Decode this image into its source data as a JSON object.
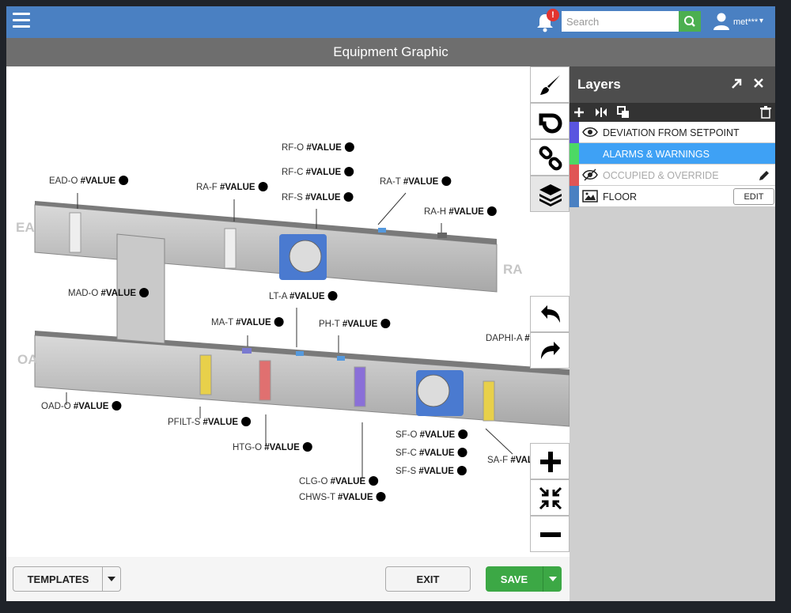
{
  "topbar": {
    "notification_badge": "!",
    "search_placeholder": "Search",
    "user_name": "met***",
    "user_caret": "▾"
  },
  "page_title": "Equipment Graphic",
  "diagram": {
    "zone_labels": {
      "ea": "EA",
      "oa": "OA",
      "ra": "RA"
    },
    "points": [
      {
        "tag": "EAD-O",
        "value": "#VALUE"
      },
      {
        "tag": "RA-F",
        "value": "#VALUE"
      },
      {
        "tag": "RF-O",
        "value": "#VALUE"
      },
      {
        "tag": "RF-C",
        "value": "#VALUE"
      },
      {
        "tag": "RF-S",
        "value": "#VALUE"
      },
      {
        "tag": "RA-T",
        "value": "#VALUE"
      },
      {
        "tag": "RA-H",
        "value": "#VALUE"
      },
      {
        "tag": "MAD-O",
        "value": "#VALUE"
      },
      {
        "tag": "LT-A",
        "value": "#VALUE"
      },
      {
        "tag": "MA-T",
        "value": "#VALUE"
      },
      {
        "tag": "PH-T",
        "value": "#VALUE"
      },
      {
        "tag": "DAPHI-A",
        "value": "#"
      },
      {
        "tag": "OAD-O",
        "value": "#VALUE"
      },
      {
        "tag": "PFILT-S",
        "value": "#VALUE"
      },
      {
        "tag": "HTG-O",
        "value": "#VALUE"
      },
      {
        "tag": "SF-O",
        "value": "#VALUE"
      },
      {
        "tag": "SF-C",
        "value": "#VALUE"
      },
      {
        "tag": "SF-S",
        "value": "#VALUE"
      },
      {
        "tag": "SA-F",
        "value": "#VAL"
      },
      {
        "tag": "CLG-O",
        "value": "#VALUE"
      },
      {
        "tag": "CHWS-T",
        "value": "#VALUE"
      }
    ]
  },
  "tools": {
    "icons": [
      "paintbrush-icon",
      "duct-icon",
      "link-icon",
      "layers-icon",
      "undo-icon",
      "redo-icon",
      "zoom-in-icon",
      "fit-icon",
      "zoom-out-icon"
    ]
  },
  "layers_panel": {
    "title": "Layers",
    "items": [
      {
        "name": "DEVIATION FROM SETPOINT",
        "color": "#5a55e0",
        "state": "visible"
      },
      {
        "name": "ALARMS & WARNINGS",
        "color": "#4cd964",
        "state": "selected"
      },
      {
        "name": "OCCUPIED & OVERRIDE",
        "color": "#e05555",
        "state": "hidden-editing"
      },
      {
        "name": "FLOOR",
        "color": "#4a80c2",
        "state": "image",
        "edit_label": "EDIT"
      }
    ]
  },
  "bottom": {
    "templates_label": "TEMPLATES",
    "exit_label": "EXIT",
    "save_label": "SAVE"
  },
  "colors": {
    "topbar": "#4a80c2",
    "save": "#3ca845",
    "selected_layer": "#3ea1f5",
    "search_button": "#4caf50"
  }
}
